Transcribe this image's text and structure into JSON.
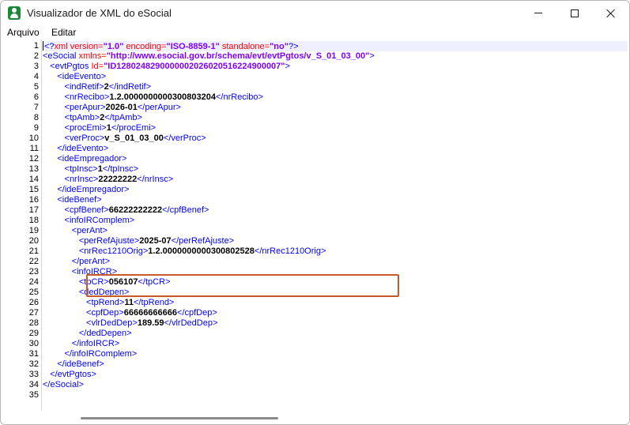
{
  "window": {
    "title": "Visualizador de XML do eSocial"
  },
  "menu": {
    "items": [
      "Arquivo",
      "Editar"
    ]
  },
  "editor": {
    "line_numbers": [
      "1",
      "2",
      "3",
      "4",
      "5",
      "6",
      "7",
      "8",
      "9",
      "10",
      "11",
      "12",
      "13",
      "14",
      "15",
      "16",
      "17",
      "18",
      "19",
      "20",
      "21",
      "22",
      "23",
      "24",
      "25",
      "26",
      "27",
      "28",
      "29",
      "30",
      "31",
      "32",
      "33",
      "34",
      "35"
    ],
    "highlighted_lines": [
      20,
      21
    ],
    "lines": [
      {
        "indent": 0,
        "parts": [
          [
            "t",
            "<?"
          ],
          [
            "a",
            "xml "
          ],
          [
            "a",
            "version="
          ],
          [
            "v",
            "\"1.0\""
          ],
          [
            "a",
            " encoding="
          ],
          [
            "v",
            "\"ISO-8859-1\""
          ],
          [
            "a",
            " standalone="
          ],
          [
            "v",
            "\"no\""
          ],
          [
            "t",
            "?>"
          ]
        ]
      },
      {
        "indent": 0,
        "parts": [
          [
            "t",
            "<eSocial "
          ],
          [
            "a",
            "xmlns="
          ],
          [
            "v",
            "\"http://www.esocial.gov.br/schema/evt/evtPgtos/v_S_01_03_00\""
          ],
          [
            "t",
            ">"
          ]
        ]
      },
      {
        "indent": 1,
        "parts": [
          [
            "t",
            "<evtPgtos "
          ],
          [
            "a",
            "Id="
          ],
          [
            "v",
            "\"ID1280248290000002026020516224900007\""
          ],
          [
            "t",
            ">"
          ]
        ]
      },
      {
        "indent": 2,
        "parts": [
          [
            "t",
            "<ideEvento>"
          ]
        ]
      },
      {
        "indent": 3,
        "parts": [
          [
            "t",
            "<indRetif>"
          ],
          [
            "x",
            "2"
          ],
          [
            "t",
            "</indRetif>"
          ]
        ]
      },
      {
        "indent": 3,
        "parts": [
          [
            "t",
            "<nrRecibo>"
          ],
          [
            "x",
            "1.2.0000000000300803204"
          ],
          [
            "t",
            "</nrRecibo>"
          ]
        ]
      },
      {
        "indent": 3,
        "parts": [
          [
            "t",
            "<perApur>"
          ],
          [
            "x",
            "2026-01"
          ],
          [
            "t",
            "</perApur>"
          ]
        ]
      },
      {
        "indent": 3,
        "parts": [
          [
            "t",
            "<tpAmb>"
          ],
          [
            "x",
            "2"
          ],
          [
            "t",
            "</tpAmb>"
          ]
        ]
      },
      {
        "indent": 3,
        "parts": [
          [
            "t",
            "<procEmi>"
          ],
          [
            "x",
            "1"
          ],
          [
            "t",
            "</procEmi>"
          ]
        ]
      },
      {
        "indent": 3,
        "parts": [
          [
            "t",
            "<verProc>"
          ],
          [
            "x",
            "v_S_01_03_00"
          ],
          [
            "t",
            "</verProc>"
          ]
        ]
      },
      {
        "indent": 2,
        "parts": [
          [
            "t",
            "</ideEvento>"
          ]
        ]
      },
      {
        "indent": 2,
        "parts": [
          [
            "t",
            "<ideEmpregador>"
          ]
        ]
      },
      {
        "indent": 3,
        "parts": [
          [
            "t",
            "<tpInsc>"
          ],
          [
            "x",
            "1"
          ],
          [
            "t",
            "</tpInsc>"
          ]
        ]
      },
      {
        "indent": 3,
        "parts": [
          [
            "t",
            "<nrInsc>"
          ],
          [
            "x",
            "22222222"
          ],
          [
            "t",
            "</nrInsc>"
          ]
        ]
      },
      {
        "indent": 2,
        "parts": [
          [
            "t",
            "</ideEmpregador>"
          ]
        ]
      },
      {
        "indent": 2,
        "parts": [
          [
            "t",
            "<ideBenef>"
          ]
        ]
      },
      {
        "indent": 3,
        "parts": [
          [
            "t",
            "<cpfBenef>"
          ],
          [
            "x",
            "66222222222"
          ],
          [
            "t",
            "</cpfBenef>"
          ]
        ]
      },
      {
        "indent": 3,
        "parts": [
          [
            "t",
            "<infoIRComplem>"
          ]
        ]
      },
      {
        "indent": 4,
        "parts": [
          [
            "t",
            "<perAnt>"
          ]
        ]
      },
      {
        "indent": 5,
        "parts": [
          [
            "t",
            "<perRefAjuste>"
          ],
          [
            "x",
            "2025-07"
          ],
          [
            "t",
            "</perRefAjuste>"
          ]
        ]
      },
      {
        "indent": 5,
        "parts": [
          [
            "t",
            "<nrRec1210Orig>"
          ],
          [
            "x",
            "1.2.0000000000300802528"
          ],
          [
            "t",
            "</nrRec1210Orig>"
          ]
        ]
      },
      {
        "indent": 4,
        "parts": [
          [
            "t",
            "</perAnt>"
          ]
        ]
      },
      {
        "indent": 4,
        "parts": [
          [
            "t",
            "<infoIRCR>"
          ]
        ]
      },
      {
        "indent": 5,
        "parts": [
          [
            "t",
            "<tpCR>"
          ],
          [
            "x",
            "056107"
          ],
          [
            "t",
            "</tpCR>"
          ]
        ]
      },
      {
        "indent": 5,
        "parts": [
          [
            "t",
            "<dedDepen>"
          ]
        ]
      },
      {
        "indent": 6,
        "parts": [
          [
            "t",
            "<tpRend>"
          ],
          [
            "x",
            "11"
          ],
          [
            "t",
            "</tpRend>"
          ]
        ]
      },
      {
        "indent": 6,
        "parts": [
          [
            "t",
            "<cpfDep>"
          ],
          [
            "x",
            "66666666666"
          ],
          [
            "t",
            "</cpfDep>"
          ]
        ]
      },
      {
        "indent": 6,
        "parts": [
          [
            "t",
            "<vlrDedDep>"
          ],
          [
            "x",
            "189.59"
          ],
          [
            "t",
            "</vlrDedDep>"
          ]
        ]
      },
      {
        "indent": 5,
        "parts": [
          [
            "t",
            "</dedDepen>"
          ]
        ]
      },
      {
        "indent": 4,
        "parts": [
          [
            "t",
            "</infoIRCR>"
          ]
        ]
      },
      {
        "indent": 3,
        "parts": [
          [
            "t",
            "</infoIRComplem>"
          ]
        ]
      },
      {
        "indent": 2,
        "parts": [
          [
            "t",
            "</ideBenef>"
          ]
        ]
      },
      {
        "indent": 1,
        "parts": [
          [
            "t",
            "</evtPgtos>"
          ]
        ]
      },
      {
        "indent": 0,
        "parts": [
          [
            "t",
            "</eSocial>"
          ]
        ]
      },
      {
        "indent": 0,
        "parts": []
      }
    ]
  },
  "colors": {
    "tag": "#0000ff",
    "attribute": "#ff0000",
    "attribute_value": "#8000ff",
    "text": "#000000",
    "highlight_border": "#c85a2a"
  },
  "icons": {
    "app": "esocial-app-icon",
    "minimize": "minimize-icon",
    "maximize": "maximize-icon",
    "close": "close-icon"
  }
}
